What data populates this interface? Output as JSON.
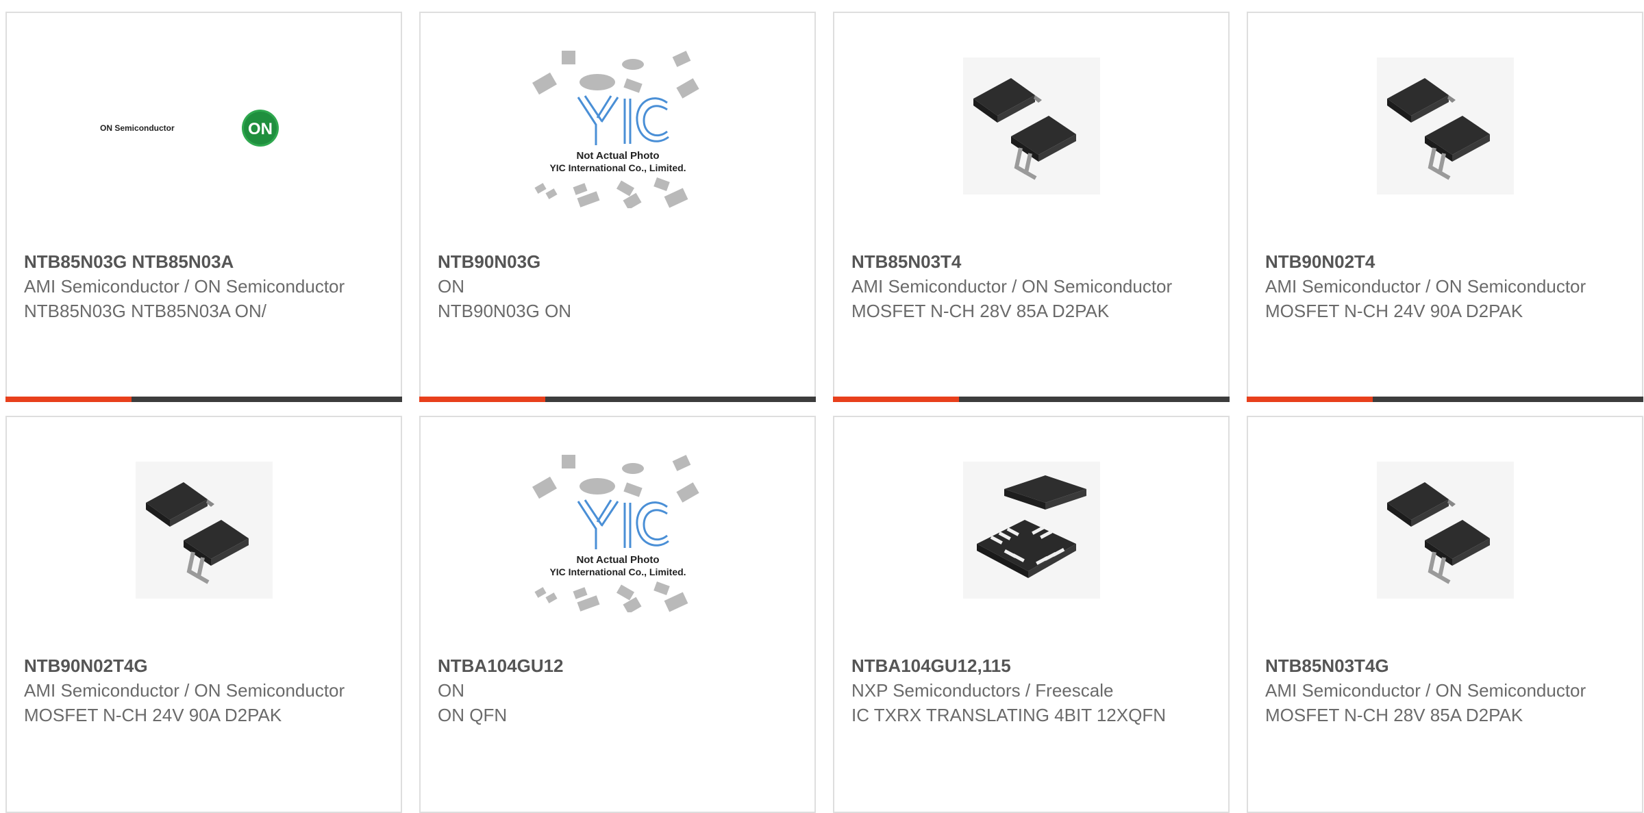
{
  "colors": {
    "accent": "#e8401c",
    "bar": "#3d3d3d",
    "border": "#dedede",
    "title": "#555555",
    "text": "#6a6a6a"
  },
  "products": [
    {
      "part": "NTB85N03G NTB85N03A",
      "maker": "AMI Semiconductor / ON Semiconductor",
      "desc": "NTB85N03G NTB85N03A ON/",
      "image": "on-semiconductor-logo",
      "logo_text": "ON Semiconductor",
      "logo_badge": "ON"
    },
    {
      "part": "NTB90N03G",
      "maker": "ON",
      "desc": "NTB90N03G ON",
      "image": "not-actual-photo",
      "placeholder_line1": "Not Actual Photo",
      "placeholder_line2": "YIC International Co., Limited."
    },
    {
      "part": "NTB85N03T4",
      "maker": "AMI Semiconductor / ON Semiconductor",
      "desc": "MOSFET N-CH 28V 85A D2PAK",
      "image": "d2pak-package"
    },
    {
      "part": "NTB90N02T4",
      "maker": "AMI Semiconductor / ON Semiconductor",
      "desc": "MOSFET N-CH 24V 90A D2PAK",
      "image": "d2pak-package"
    },
    {
      "part": "NTB90N02T4G",
      "maker": "AMI Semiconductor / ON Semiconductor",
      "desc": "MOSFET N-CH 24V 90A D2PAK",
      "image": "d2pak-package"
    },
    {
      "part": "NTBA104GU12",
      "maker": "ON",
      "desc": "ON QFN",
      "image": "not-actual-photo",
      "placeholder_line1": "Not Actual Photo",
      "placeholder_line2": "YIC International Co., Limited."
    },
    {
      "part": "NTBA104GU12,115",
      "maker": "NXP Semiconductors / Freescale",
      "desc": "IC TXRX TRANSLATING 4BIT 12XQFN",
      "image": "qfn-package"
    },
    {
      "part": "NTB85N03T4G",
      "maker": "AMI Semiconductor / ON Semiconductor",
      "desc": "MOSFET N-CH 28V 85A D2PAK",
      "image": "d2pak-package"
    }
  ]
}
